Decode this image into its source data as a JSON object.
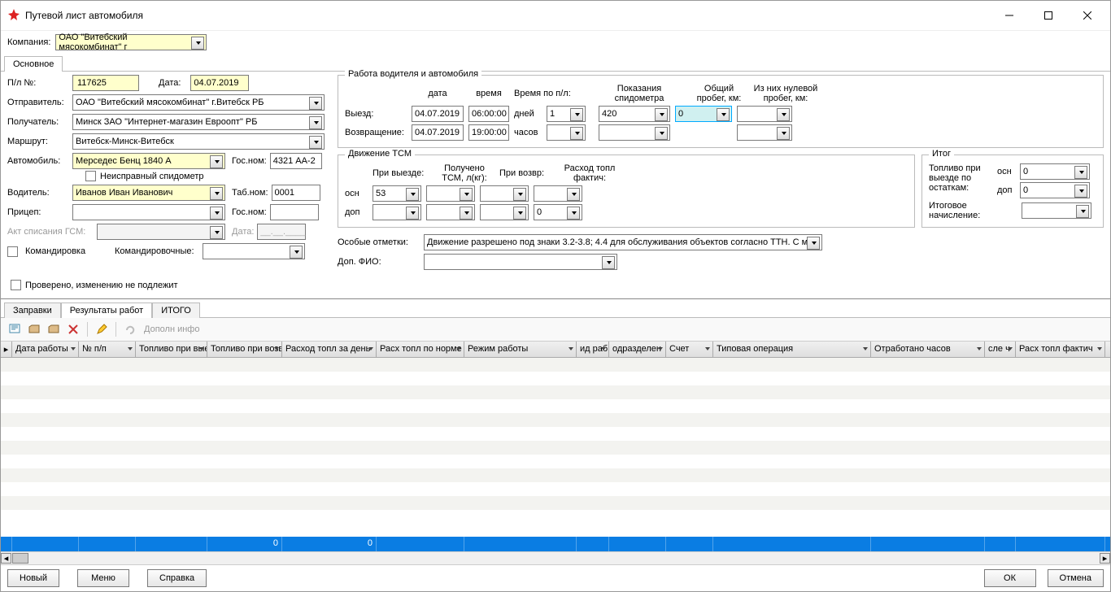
{
  "window": {
    "title": "Путевой лист автомобиля"
  },
  "header": {
    "company_label": "Компания:",
    "company": "ОАО \"Витебский мясокомбинат\" г"
  },
  "main_tab": "Основное",
  "left": {
    "pl_no_label": "П/л №:",
    "pl_no": "117625",
    "date_label": "Дата:",
    "date": "04.07.2019",
    "sender_label": "Отправитель:",
    "sender": "ОАО \"Витебский мясокомбинат\" г.Витебск РБ",
    "receiver_label": "Получатель:",
    "receiver": "Минск ЗАО \"Интернет-магазин Евроопт\" РБ",
    "route_label": "Маршрут:",
    "route": "Витебск-Минск-Витебск",
    "vehicle_label": "Автомобиль:",
    "vehicle": "Мерседес Бенц 1840 А",
    "gosnom_label": "Гос.ном:",
    "gosnom": "4321 АА-2",
    "faulty_spido": "Неисправный спидометр",
    "driver_label": "Водитель:",
    "driver": "Иванов Иван Иванович",
    "tabnom_label": "Таб.ном:",
    "tabnom": "0001",
    "trailer_label": "Прицеп:",
    "trailer": "",
    "trailer_gosnom_label": "Гос.ном:",
    "trailer_gosnom": "",
    "act_label": "Акт списания ГСМ:",
    "act": "",
    "act_date_label": "Дата:",
    "act_date": "__.__.____",
    "trip_chk": "Командировка",
    "trip_money_label": "Командировочные:",
    "trip_money": "",
    "verified": "Проверено, изменению не подлежит"
  },
  "work": {
    "legend": "Работа водителя и автомобиля",
    "col_date": "дата",
    "col_time": "время",
    "col_time_pl": "Время по п/л:",
    "col_spido": "Показания спидометра",
    "col_total": "Общий пробег, км:",
    "col_zero": "Из них нулевой пробег, км:",
    "out_label": "Выезд:",
    "out_date": "04.07.2019",
    "out_time": "06:00:00",
    "days_label": "дней",
    "days": "1",
    "spido_out": "420",
    "total_out": "0",
    "ret_label": "Возвращение:",
    "ret_date": "04.07.2019",
    "ret_time": "19:00:00",
    "hours_label": "часов",
    "hours": "",
    "spido_ret": "",
    "total_ret": "",
    "zero_ret": ""
  },
  "tsm": {
    "legend": "Движение ТСМ",
    "col1": "При выезде:",
    "col2": "Получено ТСМ, л(кг):",
    "col3": "При возвр:",
    "col4": "Расход топл фактич:",
    "osn_label": "осн",
    "osn_out": "53",
    "dop_label": "доп",
    "dop_fact": "0"
  },
  "itog": {
    "legend": "Итог",
    "fuel_out_label": "Топливо при выезде по остаткам:",
    "osn_label": "осн",
    "osn": "0",
    "dop_label": "доп",
    "dop": "0",
    "final_label": "Итоговое начисление:",
    "final": ""
  },
  "notes": {
    "special_label": "Особые отметки:",
    "special": "Движение разрешено под знаки 3.2-3.8; 4.4 для обслуживания объектов согласно ТТН. С м",
    "extra_fio_label": "Доп. ФИО:",
    "extra_fio": ""
  },
  "tabs": [
    "Заправки",
    "Результаты работ",
    "ИТОГО"
  ],
  "tabs_active": 1,
  "toolbar": {
    "extra_info": "Дополн инфо"
  },
  "grid": {
    "cols": [
      {
        "label": "",
        "w": 14
      },
      {
        "label": "Дата работы",
        "w": 82
      },
      {
        "label": "№ п/п",
        "w": 70
      },
      {
        "label": "Топливо при выезде",
        "w": 88
      },
      {
        "label": "Топливо при возвр",
        "w": 92
      },
      {
        "label": "Расход топл за день",
        "w": 116
      },
      {
        "label": "Расх топл по норме",
        "w": 108
      },
      {
        "label": "Режим работы",
        "w": 138
      },
      {
        "label": "ид раб",
        "w": 40
      },
      {
        "label": "одразделен",
        "w": 70
      },
      {
        "label": "Счет",
        "w": 58
      },
      {
        "label": "Типовая операция",
        "w": 194
      },
      {
        "label": "Отработано часов",
        "w": 140
      },
      {
        "label": "сле ч",
        "w": 38
      },
      {
        "label": "Расх топл фактич",
        "w": 110
      }
    ],
    "totals": {
      "4": "0",
      "5": "0"
    }
  },
  "footer": {
    "new": "Новый",
    "menu": "Меню",
    "help": "Справка",
    "ok": "ОК",
    "cancel": "Отмена"
  }
}
